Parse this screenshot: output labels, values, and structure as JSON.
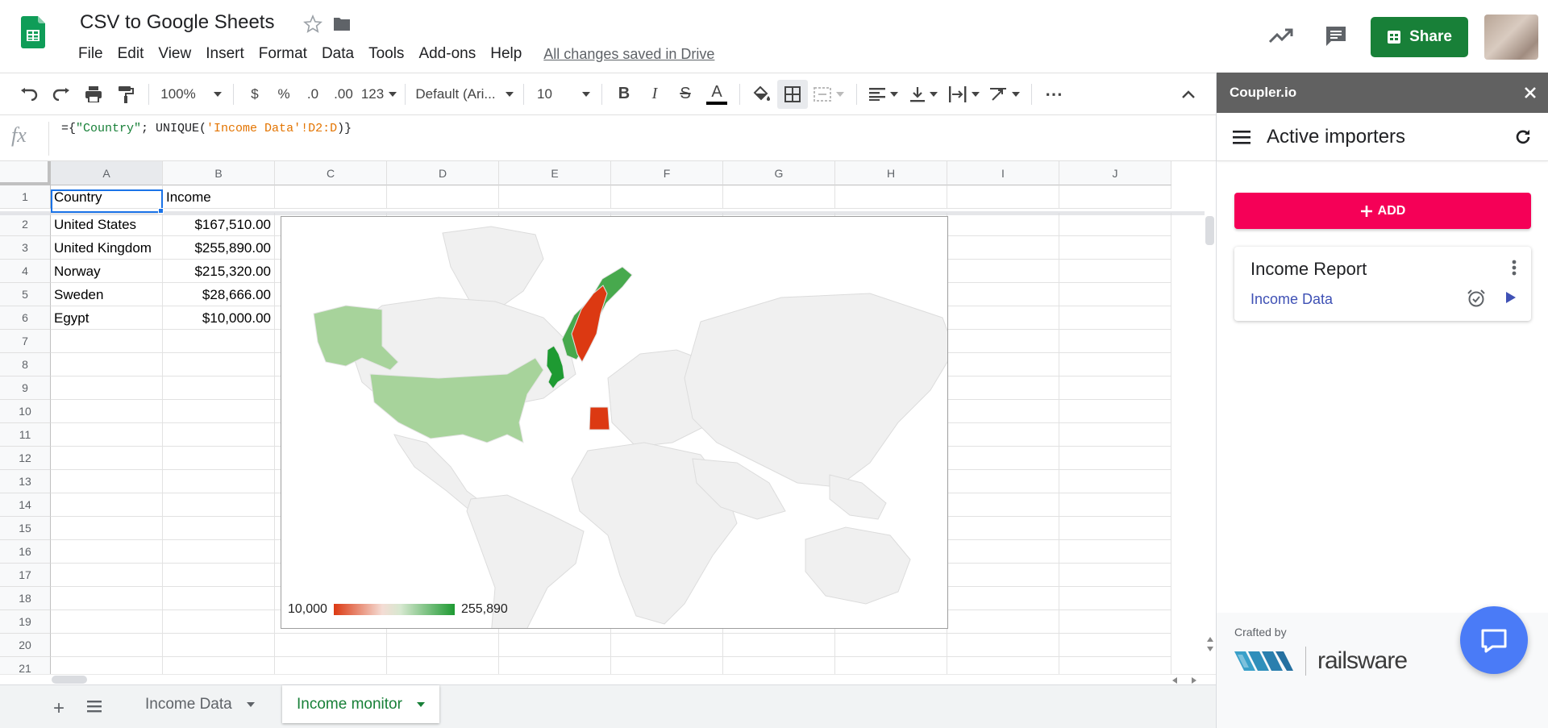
{
  "app": {
    "title": "CSV to Google Sheets",
    "save_status": "All changes saved in Drive",
    "share_label": "Share",
    "menu": [
      "File",
      "Edit",
      "View",
      "Insert",
      "Format",
      "Data",
      "Tools",
      "Add-ons",
      "Help"
    ]
  },
  "toolbar": {
    "zoom": "100%",
    "currency": "$",
    "percent": "%",
    "dec_decrease": ".0",
    "dec_increase": ".00",
    "more_formats": "123",
    "font": "Default (Ari...",
    "font_size": "10",
    "bold": "B",
    "italic": "I",
    "strike": "S",
    "text_color": "A",
    "more": "⋯"
  },
  "formula_bar": {
    "fx": "fx",
    "p1": "={",
    "p2": "\"Country\"",
    "p3": "; UNIQUE(",
    "p4": "'Income Data'!D2:D",
    "p5": ")}"
  },
  "grid": {
    "columns": [
      "A",
      "B",
      "C",
      "D",
      "E",
      "F",
      "G",
      "H",
      "I",
      "J"
    ],
    "rows": [
      "1",
      "2",
      "3",
      "4",
      "5",
      "6",
      "7",
      "8",
      "9",
      "10",
      "11",
      "12",
      "13",
      "14",
      "15",
      "16",
      "17",
      "18",
      "19",
      "20",
      "21"
    ],
    "data": [
      {
        "a": "Country",
        "b": "Income"
      },
      {
        "a": "United States",
        "b": "$167,510.00"
      },
      {
        "a": "United Kingdom",
        "b": "$255,890.00"
      },
      {
        "a": "Norway",
        "b": "$215,320.00"
      },
      {
        "a": "Sweden",
        "b": "$28,666.00"
      },
      {
        "a": "Egypt",
        "b": "$10,000.00"
      }
    ]
  },
  "chart_data": {
    "type": "geo",
    "regions": [
      "United States",
      "United Kingdom",
      "Norway",
      "Sweden",
      "Egypt"
    ],
    "values": [
      167510,
      255890,
      215320,
      28666,
      10000
    ],
    "legend_min": "10,000",
    "legend_max": "255,890",
    "color_min": "#dc3912",
    "color_max": "#1e9a32",
    "legend_position": "bottom-left"
  },
  "sheets": [
    {
      "label": "Income Data"
    },
    {
      "label": "Income monitor"
    }
  ],
  "sidebar": {
    "brand": "Coupler.io",
    "title": "Active importers",
    "add_label": "ADD",
    "card_title": "Income Report",
    "card_subtitle": "Income Data",
    "crafted_by": "Crafted by",
    "railsware": "railsware"
  },
  "colors": {
    "share_green": "#188038",
    "add_pink": "#f50057",
    "active_tab_green": "#188038",
    "sidebar_header": "#616161",
    "selection_blue": "#1a73e8"
  }
}
